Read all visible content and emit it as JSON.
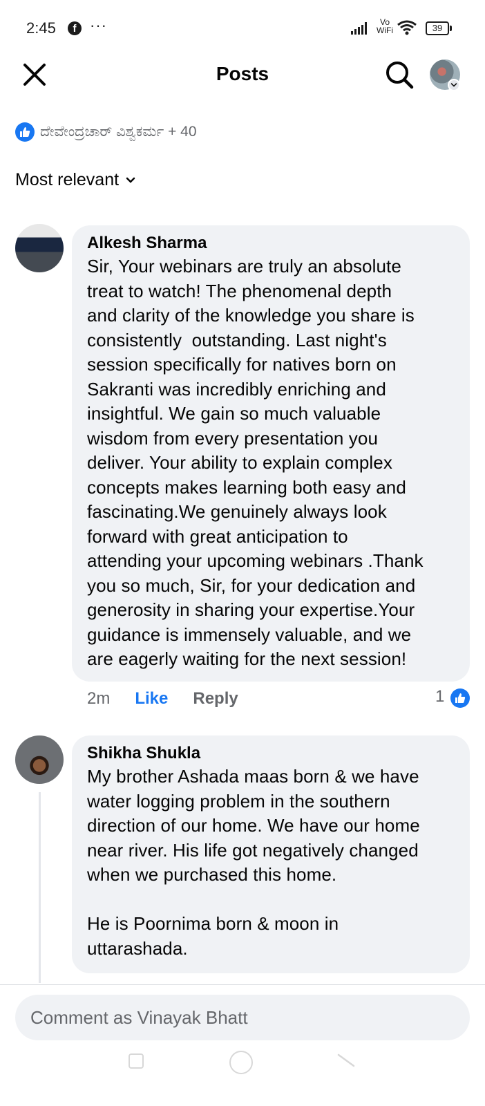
{
  "status_bar": {
    "time": "2:45",
    "app_icon": "facebook-icon",
    "more": "···",
    "network_label": "Vo WiFi",
    "battery": "39"
  },
  "header": {
    "title": "Posts",
    "close_icon": "close-icon",
    "search_icon": "search-icon",
    "profile_icon": "avatar"
  },
  "reactions": {
    "icon": "like-icon",
    "text": "ದೇವೇಂದ್ರಚಾರ್ ವಿಶ್ವಕರ್ಮ + 40"
  },
  "sort": {
    "label": "Most relevant",
    "icon": "chevron-down-icon"
  },
  "comments": [
    {
      "author": "Alkesh Sharma",
      "text": "Sir, Your webinars are truly an absolute\ntreat to watch! The phenomenal depth\nand clarity of the knowledge you share is\nconsistently  outstanding. Last night's\nsession specifically for natives born on\nSakranti was incredibly enriching and\ninsightful. We gain so much valuable\nwisdom from every presentation you\ndeliver. Your ability to explain complex\nconcepts makes learning both easy and\nfascinating.We genuinely always look\nforward with great anticipation to\nattending your upcoming webinars .Thank\nyou so much, Sir, for your dedication and\ngenerosity in sharing your expertise.Your\nguidance is immensely valuable, and we\nare eagerly waiting for the next session!",
      "time": "2m",
      "like_label": "Like",
      "reply_label": "Reply",
      "reaction_count": "1"
    },
    {
      "author": "Shikha Shukla",
      "text": "My brother Ashada maas born & we have\nwater logging problem in the southern\ndirection of our home. We have our home\nnear river. His life got negatively changed\nwhen we purchased this home.\n\nHe is Poornima born & moon in\nuttarashada."
    }
  ],
  "composer": {
    "placeholder": "Comment as Vinayak Bhatt"
  },
  "colors": {
    "accent": "#1877f2",
    "bubble": "#f0f2f5",
    "secondary_text": "#65676b"
  }
}
